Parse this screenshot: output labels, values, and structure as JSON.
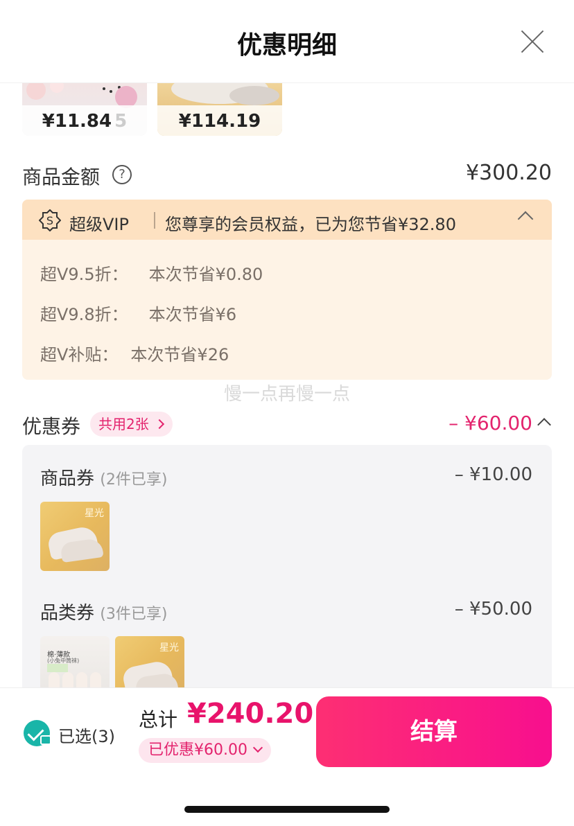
{
  "header": {
    "title": "优惠明细"
  },
  "top_products": [
    {
      "price": "¥11.84",
      "extra": "5"
    },
    {
      "price": "¥114.19"
    }
  ],
  "product_amount": {
    "label": "商品金额",
    "help": "?",
    "value": "¥300.20"
  },
  "vip": {
    "label": "超级VIP",
    "summary": "您尊享的会员权益，已为您节省¥32.80",
    "items": [
      {
        "name": "超V9.5折：",
        "saving": "本次节省¥0.80"
      },
      {
        "name": "超V9.8折：",
        "saving": "本次节省¥6"
      },
      {
        "name": "超V补贴：",
        "saving": "本次节省¥26"
      }
    ]
  },
  "watermark": "慢一点再慢一点",
  "coupons": {
    "label": "优惠券",
    "pill": "共用2张",
    "value": "– ¥60.00",
    "groups": [
      {
        "label": "商品券",
        "sub": "(2件已享)",
        "value": "– ¥10.00"
      },
      {
        "label": "品类券",
        "sub": "(3件已享)",
        "value": "– ¥50.00"
      }
    ],
    "product_texts": {
      "shoe": "星光",
      "sock_title": "棉·薄款",
      "sock_sub": "(小兔中筒袜)"
    }
  },
  "footer": {
    "selected": "已选(3)",
    "total_label": "总计",
    "total_value": "¥240.20",
    "saved": "已优惠¥60.00",
    "checkout": "结算"
  },
  "colors": {
    "accent": "#e3236d",
    "vip_bg": "#fef3e6",
    "check": "#19b5a8"
  }
}
